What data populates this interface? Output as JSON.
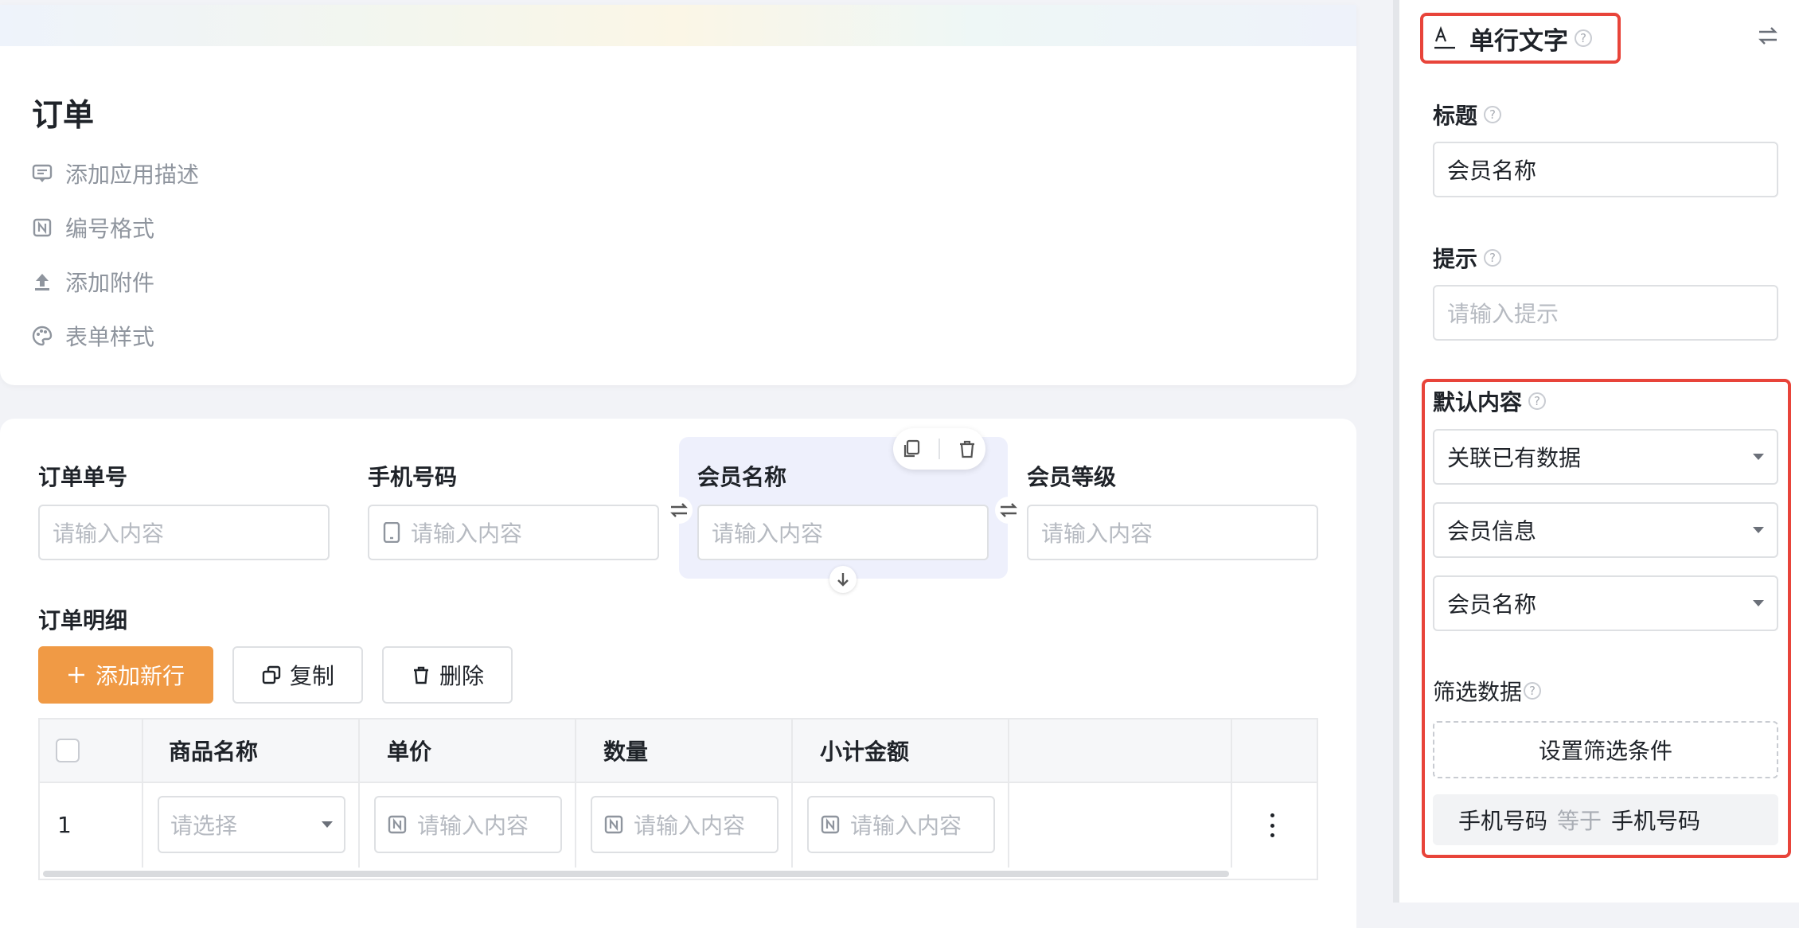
{
  "app": {
    "title": "订单",
    "meta": [
      {
        "icon": "comment-icon",
        "label": "添加应用描述"
      },
      {
        "icon": "numbering-icon",
        "label": "编号格式"
      },
      {
        "icon": "upload-icon",
        "label": "添加附件"
      },
      {
        "icon": "palette-icon",
        "label": "表单样式"
      }
    ]
  },
  "form": {
    "fields": [
      {
        "label": "订单单号",
        "placeholder": "请输入内容"
      },
      {
        "label": "手机号码",
        "placeholder": "请输入内容"
      },
      {
        "label": "会员名称",
        "placeholder": "请输入内容"
      },
      {
        "label": "会员等级",
        "placeholder": "请输入内容"
      }
    ],
    "detail": {
      "title": "订单明细",
      "add_label": "添加新行",
      "copy_label": "复制",
      "delete_label": "删除",
      "columns": [
        "商品名称",
        "单价",
        "数量",
        "小计金额"
      ],
      "row": {
        "index": "1",
        "select_placeholder": "请选择",
        "input_placeholder": "请输入内容"
      }
    }
  },
  "panel": {
    "field_type": "单行文字",
    "title_label": "标题",
    "title_value": "会员名称",
    "hint_label": "提示",
    "hint_placeholder": "请输入提示",
    "default_label": "默认内容",
    "default_mode": "关联已有数据",
    "source_form": "会员信息",
    "source_field": "会员名称",
    "filter_label": "筛选数据",
    "filter_button": "设置筛选条件",
    "condition": {
      "left": "手机号码",
      "op": "等于",
      "right": "手机号码"
    }
  },
  "colors": {
    "accent": "#f09a45",
    "highlight": "#e8443a",
    "selected_bg": "#eef0fc"
  }
}
